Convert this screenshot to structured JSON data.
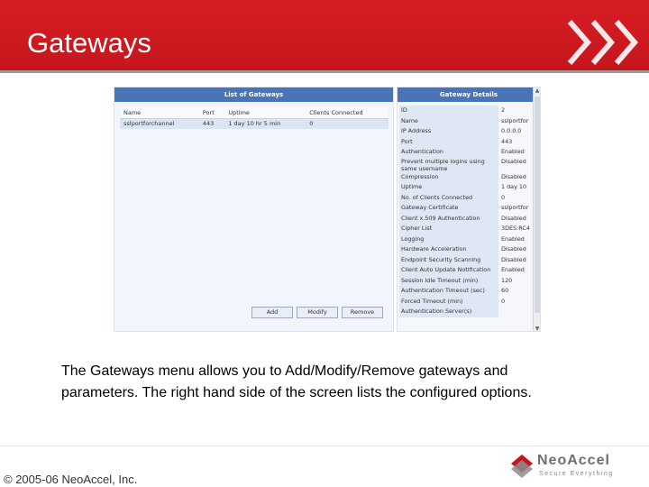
{
  "slide": {
    "title": "Gateways",
    "caption_line1": "The Gateways menu allows you to Add/Modify/Remove gateways and",
    "caption_line2": "parameters. The right hand side of the screen lists the configured options.",
    "copyright": "© 2005-06 NeoAccel, Inc.",
    "brand_color": "#c5161c"
  },
  "logo": {
    "name": "NeoAccel",
    "tagline": "Secure Everything",
    "icon": "neoaccel-diamond-logo"
  },
  "gateway_list": {
    "title": "List of Gateways",
    "columns": [
      "Name",
      "Port",
      "Uptime",
      "Clients Connected"
    ],
    "rows": [
      [
        "sslportforchannel",
        "443",
        "1 day 10 hr 5 min",
        "0"
      ]
    ],
    "buttons": {
      "add": "Add",
      "modify": "Modify",
      "remove": "Remove"
    }
  },
  "gateway_details": {
    "title": "Gateway Details",
    "rows": [
      {
        "key": "ID",
        "value": "2"
      },
      {
        "key": "Name",
        "value": "sslportfor"
      },
      {
        "key": "IP Address",
        "value": "0.0.0.0"
      },
      {
        "key": "Port",
        "value": "443"
      },
      {
        "key": "Authentication",
        "value": "Enabled"
      },
      {
        "key": "Prevent multiple logins using same username",
        "value": "Disabled"
      },
      {
        "key": "Compression",
        "value": "Disabled"
      },
      {
        "key": "Uptime",
        "value": "1 day 10"
      },
      {
        "key": "No. of Clients Connected",
        "value": "0"
      },
      {
        "key": "Gateway Certificate",
        "value": "sslportfor"
      },
      {
        "key": "Client x.509 Authentication",
        "value": "Disabled"
      },
      {
        "key": "Cipher List",
        "value": "3DES:RC4"
      },
      {
        "key": "Logging",
        "value": "Enabled"
      },
      {
        "key": "Hardware Acceleration",
        "value": "Disabled"
      },
      {
        "key": "Endpoint Security Scanning",
        "value": "Disabled"
      },
      {
        "key": "Client Auto Update Notification",
        "value": "Enabled"
      },
      {
        "key": "Session Idle Timeout (min)",
        "value": "120"
      },
      {
        "key": "Authentication Timeout (sec)",
        "value": "60"
      },
      {
        "key": "Forced Timeout (min)",
        "value": "0"
      },
      {
        "key": "Authentication Server(s)",
        "value": ""
      }
    ]
  }
}
